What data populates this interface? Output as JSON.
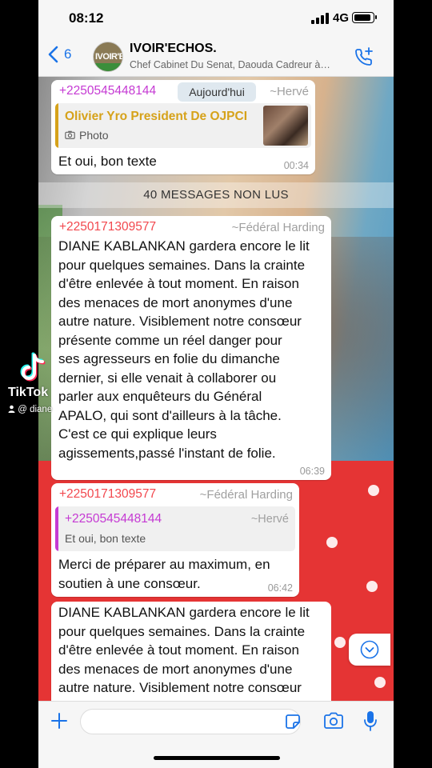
{
  "status": {
    "time": "08:12",
    "network": "4G"
  },
  "header": {
    "back_count": "6",
    "group_name": "IVOIR'ECHOS.",
    "subtitle": "Chef Cabinet Du Senat, Daouda Cadreur à…",
    "avatar_text": "IVOIR'E"
  },
  "messages": [
    {
      "sender": "+2250545448144",
      "alias": "~Hervé",
      "reply_title": "Olivier Yro President De OJPCI",
      "reply_type": "Photo",
      "text": "Et oui, bon texte",
      "time": "00:34"
    },
    {
      "sender": "+2250171309577",
      "alias": "~Fédéral Harding",
      "lines": [
        "DIANE KABLANKAN gardera encore le lit",
        "pour quelques semaines. Dans la crainte",
        "d'être enlevée à tout moment. En raison",
        "des menaces de mort anonymes d'une",
        "autre nature. Visiblement notre consœur",
        "présente comme un réel danger pour",
        "ses agresseurs en folie du dimanche",
        "dernier, si elle venait à collaborer ou",
        "parler aux enquêteurs du Général",
        "APALO, qui sont d'ailleurs à la tâche.",
        "C'est ce qui explique leurs",
        "agissements,passé l'instant de folie."
      ],
      "time": "06:39"
    },
    {
      "sender": "+2250171309577",
      "alias": "~Fédéral Harding",
      "quoted_sender": "+2250545448144",
      "quoted_alias": "~Hervé",
      "quoted_text": "Et oui, bon texte",
      "lines": [
        "Merci de préparer au maximum, en",
        "soutien à une consœur."
      ],
      "time": "06:42"
    },
    {
      "lines": [
        "DIANE KABLANKAN gardera encore le lit",
        "pour quelques semaines. Dans la crainte",
        "d'être enlevée à tout moment. En raison",
        "des menaces de mort anonymes d'une",
        "autre nature. Visiblement notre consœur"
      ]
    }
  ],
  "date_chip": "Aujourd'hui",
  "unread_banner": "40 MESSAGES NON LUS",
  "overlay": {
    "brand": "TikTok",
    "user": "@ diane"
  },
  "input": {
    "value": ""
  },
  "colors": {
    "sender_magenta": "#c53ad3",
    "sender_red": "#f2484e",
    "quote_yellow": "#d6a21a",
    "accent_blue": "#1a73e8"
  },
  "icons": [
    "chevron-left-icon",
    "phone-plus-icon",
    "camera-icon",
    "plus-icon",
    "sticker-icon",
    "mic-icon",
    "chevron-down-icon",
    "tiktok-icon",
    "user-icon"
  ]
}
